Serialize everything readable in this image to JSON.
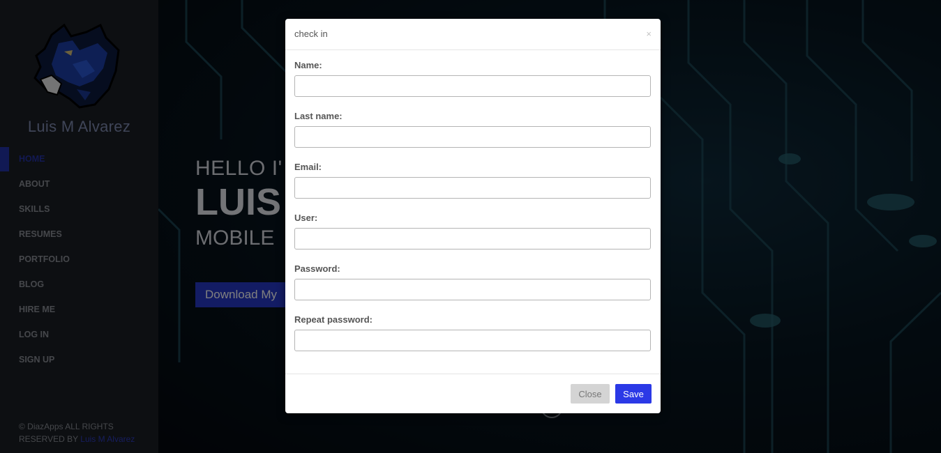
{
  "sidebar": {
    "owner_name": "Luis M Alvarez",
    "nav": [
      {
        "label": "HOME",
        "active": true
      },
      {
        "label": "ABOUT"
      },
      {
        "label": "SKILLS"
      },
      {
        "label": "RESUMES"
      },
      {
        "label": "PORTFOLIO"
      },
      {
        "label": "BLOG"
      },
      {
        "label": "HIRE ME"
      },
      {
        "label": "LOG IN"
      },
      {
        "label": "SIGN UP"
      }
    ],
    "copyright_prefix": "© DiazApps ALL RIGHTS RESERVED BY",
    "copyright_link": "Luis M Alvarez",
    "logo_icon": "panther-icon"
  },
  "hero": {
    "hello": "HELLO I'",
    "name": "LUIS",
    "role": "MOBILE",
    "download_label": "Download My",
    "accent_color": "#2638c9"
  },
  "modal": {
    "title": "check in",
    "close_symbol": "×",
    "fields": [
      {
        "label": "Name:",
        "value": ""
      },
      {
        "label": "Last name:",
        "value": ""
      },
      {
        "label": "Email:",
        "value": ""
      },
      {
        "label": "User:",
        "value": ""
      },
      {
        "label": "Password:",
        "value": ""
      },
      {
        "label": "Repeat password:",
        "value": ""
      }
    ],
    "close_button": "Close",
    "save_button": "Save"
  }
}
